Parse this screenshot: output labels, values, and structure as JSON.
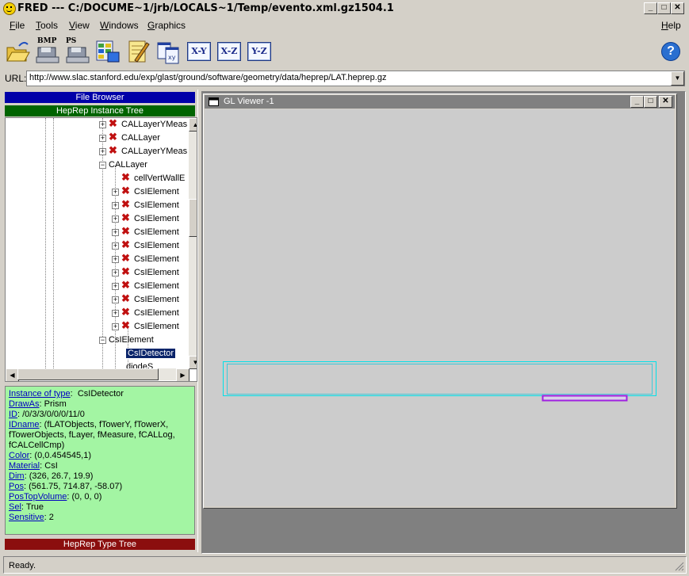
{
  "window": {
    "title": "FRED  --- C:/DOCUME~1/jrb/LOCALS~1/Temp/evento.xml.gz1504.1"
  },
  "menu": {
    "file": {
      "accel": "F",
      "rest": "ile"
    },
    "tools": {
      "accel": "T",
      "rest": "ools"
    },
    "view": {
      "accel": "V",
      "rest": "iew"
    },
    "windows": {
      "accel": "W",
      "rest": "indows"
    },
    "graphics": {
      "accel": "G",
      "rest": "raphics"
    },
    "help": {
      "accel": "H",
      "rest": "elp"
    }
  },
  "toolbar": {
    "bmp_label": "BMP",
    "ps_label": "PS",
    "xy_label": "X-Y",
    "xz_label": "X-Z",
    "yz_label": "Y-Z",
    "help_glyph": "?"
  },
  "url": {
    "label": "URL:",
    "value": "http://www.slac.stanford.edu/exp/glast/ground/software/geometry/data/heprep/LAT.heprep.gz"
  },
  "panels": {
    "file_browser": "File Browser",
    "instance_tree": "HepRep Instance Tree",
    "type_tree": "HepRep Type Tree"
  },
  "tree": {
    "nodes": [
      {
        "label": "CALLayerYMeas",
        "expander": "+",
        "icon": "x",
        "level": 2
      },
      {
        "label": "CALLayer",
        "expander": "+",
        "icon": "x",
        "level": 2
      },
      {
        "label": "CALLayerYMeas",
        "expander": "+",
        "icon": "x",
        "level": 2
      },
      {
        "label": "CALLayer",
        "expander": "-",
        "icon": "none",
        "level": 1
      },
      {
        "label": "cellVertWallE",
        "expander": "",
        "icon": "x",
        "level": 3
      },
      {
        "label": "CsIElement",
        "expander": "+",
        "icon": "x",
        "level": 3
      },
      {
        "label": "CsIElement",
        "expander": "+",
        "icon": "x",
        "level": 3
      },
      {
        "label": "CsIElement",
        "expander": "+",
        "icon": "x",
        "level": 3
      },
      {
        "label": "CsIElement",
        "expander": "+",
        "icon": "x",
        "level": 3
      },
      {
        "label": "CsIElement",
        "expander": "+",
        "icon": "x",
        "level": 3
      },
      {
        "label": "CsIElement",
        "expander": "+",
        "icon": "x",
        "level": 3
      },
      {
        "label": "CsIElement",
        "expander": "+",
        "icon": "x",
        "level": 3
      },
      {
        "label": "CsIElement",
        "expander": "+",
        "icon": "x",
        "level": 3
      },
      {
        "label": "CsIElement",
        "expander": "+",
        "icon": "x",
        "level": 3
      },
      {
        "label": "CsIElement",
        "expander": "+",
        "icon": "x",
        "level": 3
      },
      {
        "label": "CsIElement",
        "expander": "+",
        "icon": "x",
        "level": 3
      },
      {
        "label": "CsIElement",
        "expander": "-",
        "icon": "none",
        "level": 2
      },
      {
        "label": "CsIDetector",
        "expander": "",
        "icon": "none",
        "level": 3,
        "selected": true
      },
      {
        "label": "diodeS",
        "expander": "",
        "icon": "none",
        "level": 3
      }
    ]
  },
  "props": {
    "instance_of_type": {
      "key": "Instance of type",
      "value": "CsIDetector"
    },
    "drawas": {
      "key": "DrawAs",
      "value": "Prism"
    },
    "id": {
      "key": "ID",
      "value": "/0/3/3/0/0/0/11/0"
    },
    "idname": {
      "key": "IDname",
      "value": "(fLATObjects, fTowerY, fTowerX, fTowerObjects, fLayer, fMeasure, fCALLog, fCALCellCmp)"
    },
    "color": {
      "key": "Color",
      "value": "(0,0.454545,1)"
    },
    "material": {
      "key": "Material",
      "value": "CsI"
    },
    "dim": {
      "key": "Dim",
      "value": "(326, 26.7, 19.9)"
    },
    "pos": {
      "key": "Pos",
      "value": "(561.75, 714.87, -58.07)"
    },
    "postopvolume": {
      "key": "PosTopVolume",
      "value": "(0, 0, 0)"
    },
    "sel": {
      "key": "Sel",
      "value": "True"
    },
    "sensitive": {
      "key": "Sensitive",
      "value": "2"
    }
  },
  "viewer": {
    "title": "GL Viewer -1"
  },
  "status": {
    "text": "Ready."
  },
  "colors": {
    "accent_blue": "#0000a8",
    "green_header": "#006400",
    "red_header": "#8b0e0e",
    "props_bg": "#a3f5a3",
    "cyan_outline": "#00e0e8",
    "magenta_bar": "#a020e0"
  }
}
